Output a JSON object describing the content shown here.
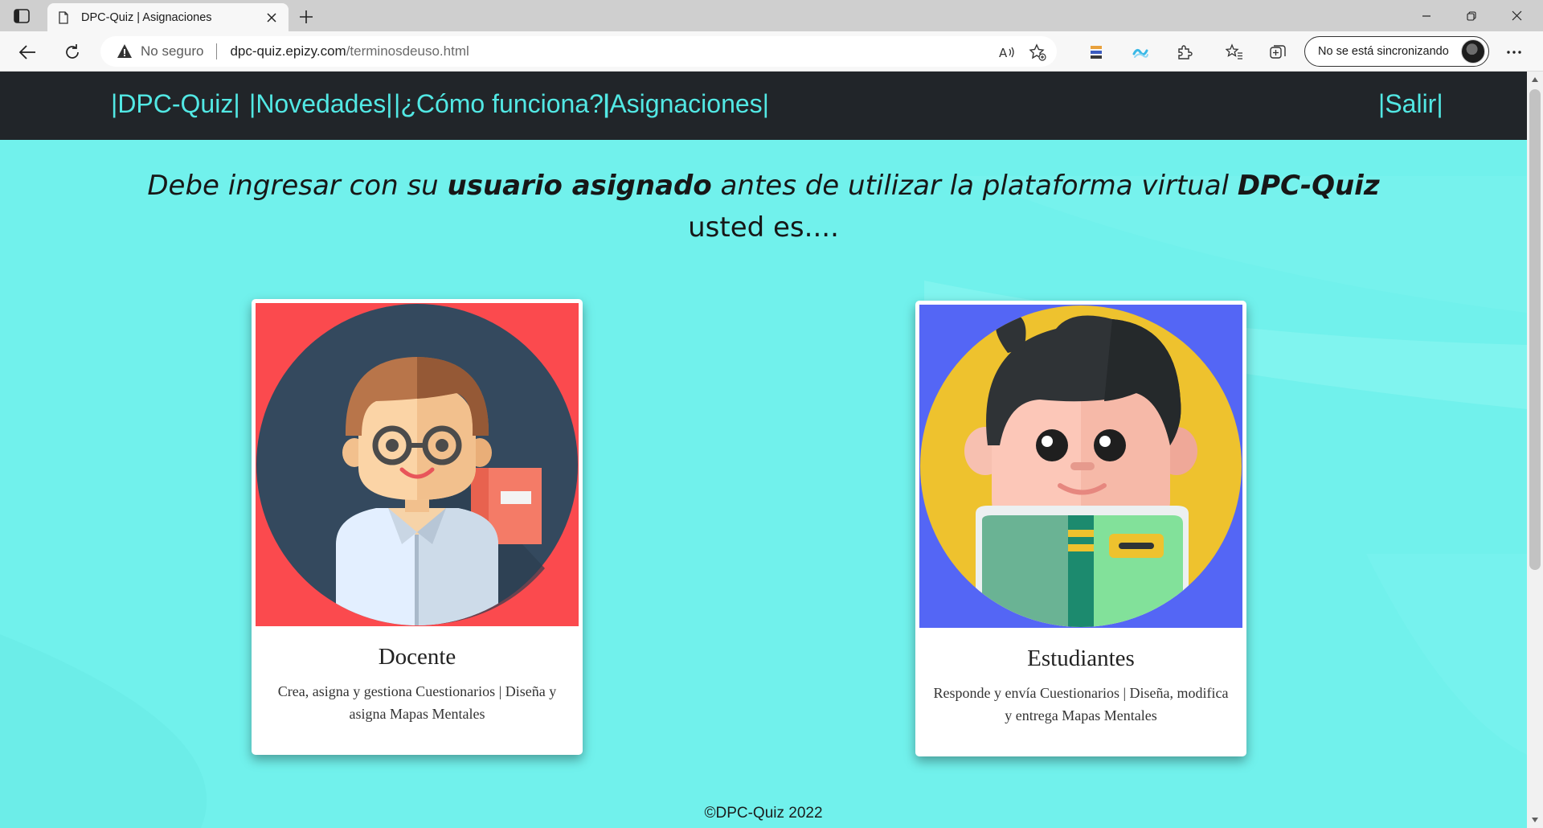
{
  "browser": {
    "tab_title": "DPC-Quiz | Asignaciones",
    "security_label": "No seguro",
    "url_domain": "dpc-quiz.epizy.com",
    "url_path": "/terminosdeuso.html",
    "sync_label": "No se está sincronizando"
  },
  "nav": {
    "brand": "|DPC-Quiz|",
    "news": "|Novedades|",
    "how": "|¿Cómo funciona?|",
    "assign": "|Asignaciones|",
    "logout": "|Salir|"
  },
  "headline": {
    "part1": "Debe ingresar con su ",
    "strong1": "usuario asignado",
    "part2": " antes de utilizar la plataforma virtual ",
    "strong2": "DPC-Quiz",
    "line2": "usted es...."
  },
  "cards": [
    {
      "title": "Docente",
      "text": "Crea, asigna y gestiona Cuestionarios | Diseña y asigna Mapas Mentales"
    },
    {
      "title": "Estudiantes",
      "text": "Responde y envía Cuestionarios | Diseña, modifica y entrega Mapas Mentales"
    }
  ],
  "footer": "©DPC-Quiz 2022",
  "colors": {
    "page_bg": "#71f1ec",
    "navbar_bg": "#212529",
    "nav_link": "#52e8e4",
    "teacher_card_bg": "#fb4a4e",
    "student_card_bg": "#5466f5"
  }
}
